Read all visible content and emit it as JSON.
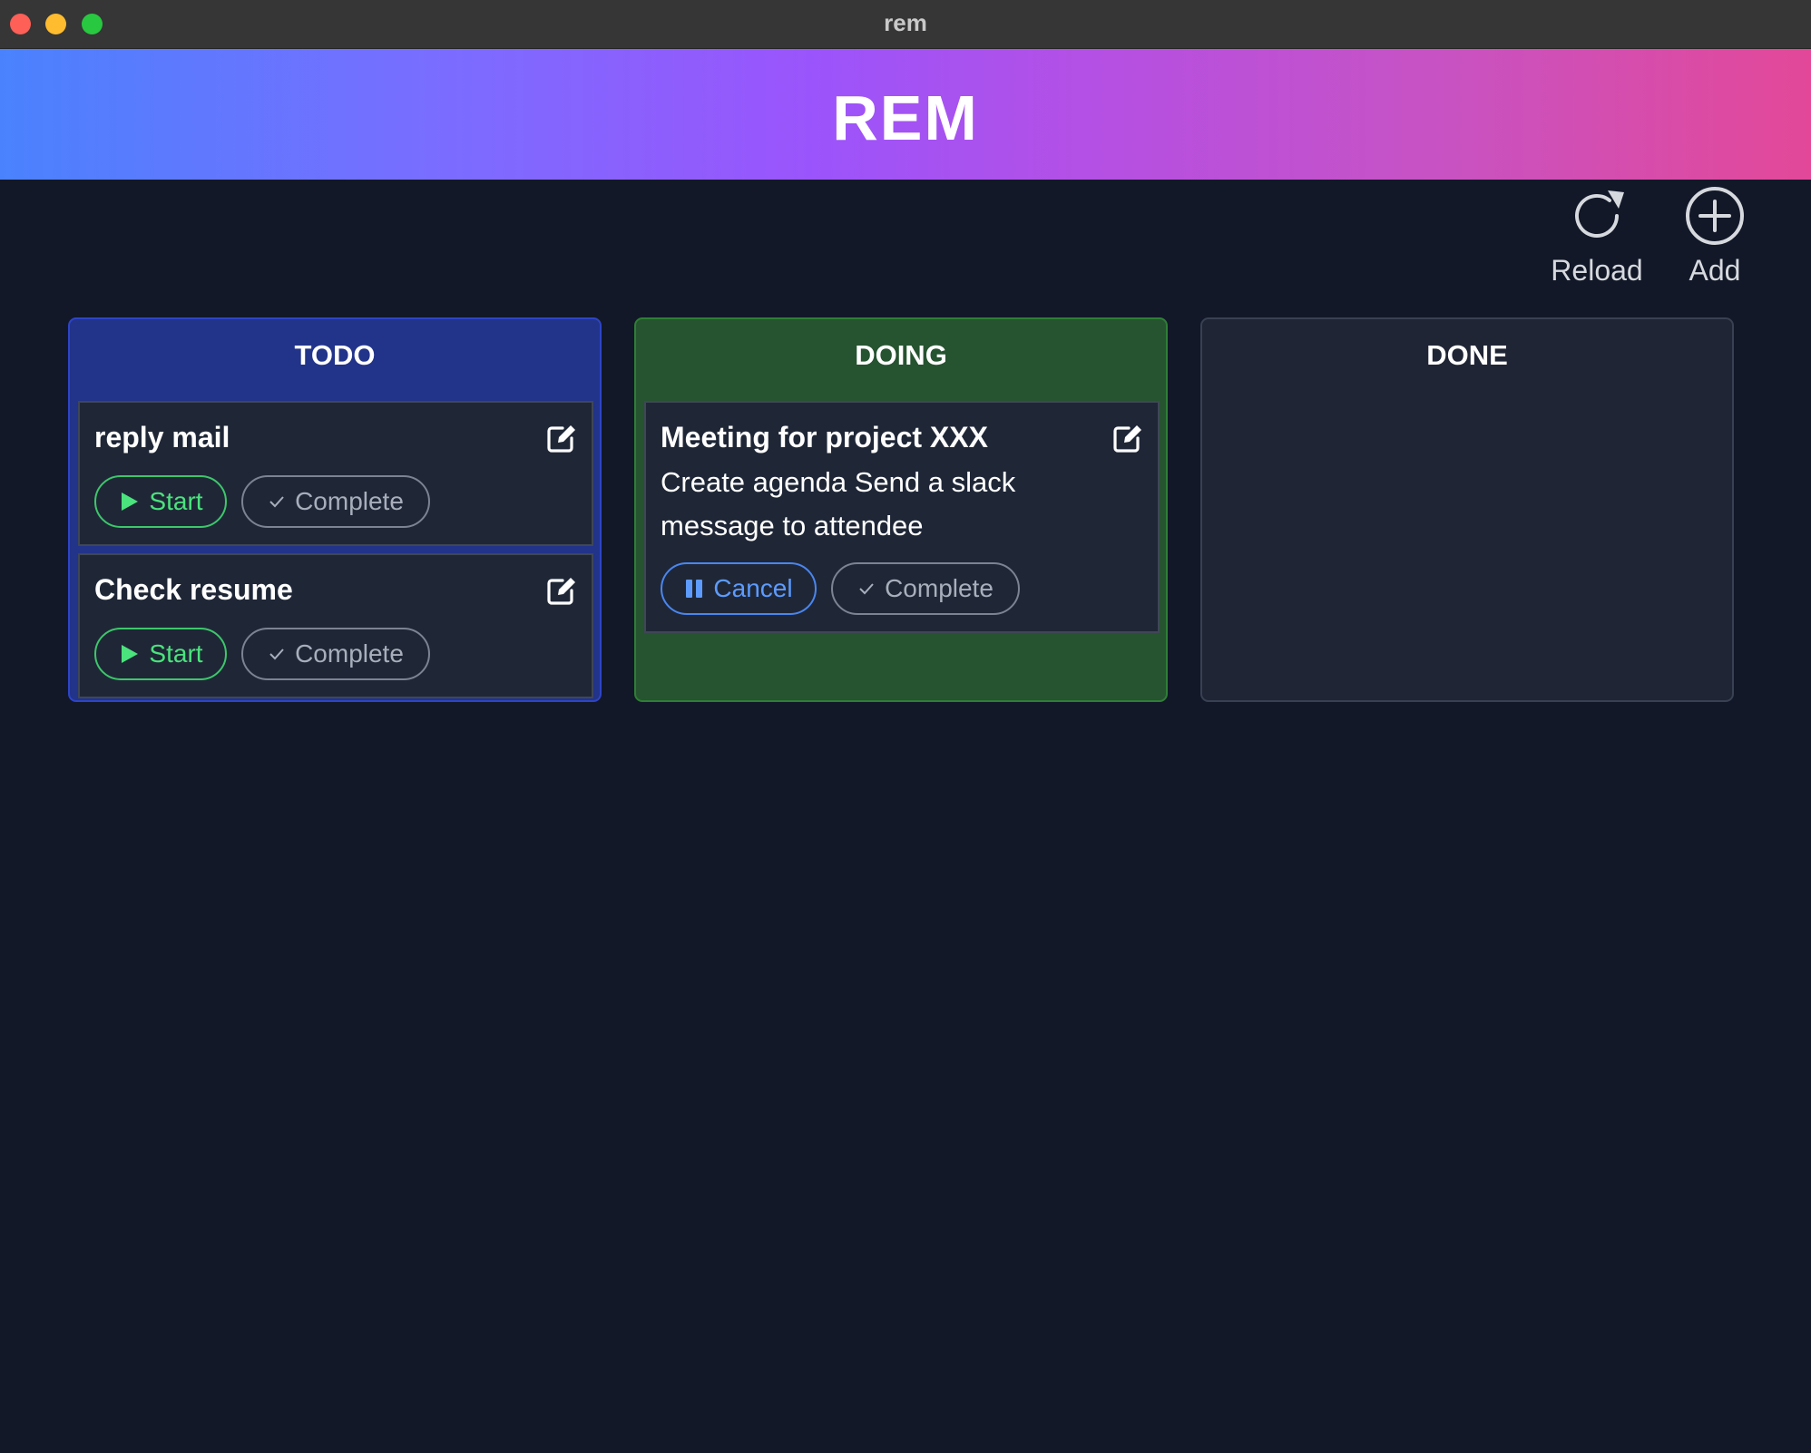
{
  "window": {
    "title": "rem"
  },
  "header": {
    "title": "REM"
  },
  "toolbar": {
    "reload_label": "Reload",
    "add_label": "Add"
  },
  "columns": [
    {
      "title": "TODO",
      "color": "#22338a",
      "cards": [
        {
          "title": "reply mail",
          "start_label": "Start",
          "complete_label": "Complete"
        },
        {
          "title": "Check resume",
          "start_label": "Start",
          "complete_label": "Complete"
        }
      ]
    },
    {
      "title": "DOING",
      "color": "#265330",
      "cards": [
        {
          "title": "Meeting for project XXX",
          "description": "Create agenda Send a slack message to attendee",
          "cancel_label": "Cancel",
          "complete_label": "Complete"
        }
      ]
    },
    {
      "title": "DONE",
      "color": "#1f2534",
      "cards": []
    }
  ],
  "colors": {
    "start": "#4be37d",
    "cancel": "#5d9bff",
    "background": "#121828"
  }
}
